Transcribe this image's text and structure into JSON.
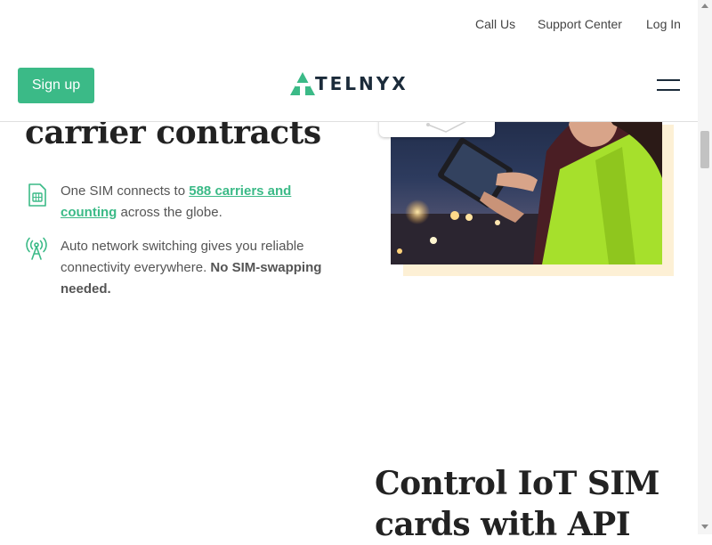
{
  "topnav": {
    "call_us": "Call Us",
    "support_center": "Support Center",
    "log_in": "Log In"
  },
  "header": {
    "signup_label": "Sign up",
    "logo_text": "TELNYX",
    "menu_icon": "hamburger-menu-icon"
  },
  "section1": {
    "heading": "carrier contracts",
    "features": [
      {
        "icon": "sim-card-icon",
        "text_before": "One SIM connects to ",
        "link_text": "588 carriers and counting",
        "text_after": " across the globe."
      },
      {
        "icon": "antenna-icon",
        "text": "Auto network switching gives you reliable connectivity everywhere. ",
        "bold_text": "No SIM-swapping needed."
      }
    ],
    "photo": "woman-with-tablet-photo"
  },
  "section2": {
    "heading_line1": "Control IoT SIM",
    "heading_line2": "cards with API"
  },
  "colors": {
    "accent": "#3bba87",
    "heading": "#222222",
    "body_text": "#555555",
    "logo_dark": "#1b2b3a",
    "photo_backdrop": "#fdf0d5"
  }
}
